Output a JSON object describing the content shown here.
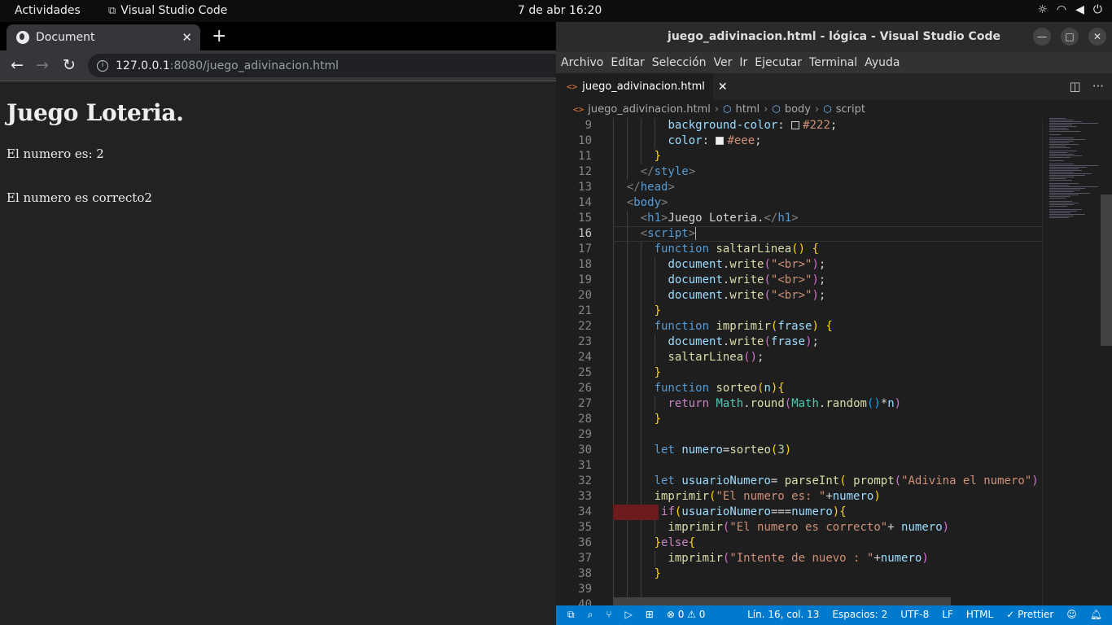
{
  "topbar": {
    "activities": "Actividades",
    "app_name": "Visual Studio Code",
    "clock": "7 de abr  16:20",
    "tray_icons": [
      "brightness-icon",
      "wifi-icon",
      "volume-icon",
      "power-icon"
    ]
  },
  "browser": {
    "tab_title": "Document",
    "url_host": "127.0.0.1",
    "url_path": ":8080/juego_adivinacion.html",
    "page": {
      "heading": "Juego Loteria.",
      "line1": "El numero es: 2",
      "line2": "El numero es correcto2"
    }
  },
  "vscode": {
    "window_title": "juego_adivinacion.html - lógica - Visual Studio Code",
    "menu": [
      "Archivo",
      "Editar",
      "Selección",
      "Ver",
      "Ir",
      "Ejecutar",
      "Terminal",
      "Ayuda"
    ],
    "tab_label": "juego_adivinacion.html",
    "breadcrumb": {
      "file": "juego_adivinacion.html",
      "b1": "html",
      "b2": "body",
      "b3": "script"
    },
    "status": {
      "errors": "0",
      "warnings": "0",
      "position": "Lín. 16, col. 13",
      "spaces": "Espacios: 2",
      "encoding": "UTF-8",
      "eol": "LF",
      "language": "HTML",
      "formatter": "Prettier"
    },
    "colors": {
      "statusbar": "#007acc",
      "editor_bg": "#1e1e1e"
    }
  },
  "code_lines": [
    {
      "n": "9",
      "html": "<span class='prop'>background-color</span>: <span class='sw' style='background:#222'></span><span class='str'>#222</span>;"
    },
    {
      "n": "10",
      "html": "<span class='prop'>color</span>: <span class='sw' style='background:#eee'></span><span class='str'>#eee</span>;"
    },
    {
      "n": "11",
      "html": "<span class='br'>}</span>"
    },
    {
      "n": "12",
      "html": "<span class='ang'>&lt;/</span><span class='tag'>style</span><span class='ang'>&gt;</span>"
    },
    {
      "n": "13",
      "html": "<span class='ang'>&lt;/</span><span class='tag'>head</span><span class='ang'>&gt;</span>"
    },
    {
      "n": "14",
      "html": "<span class='ang'>&lt;</span><span class='tag'>body</span><span class='ang'>&gt;</span>"
    },
    {
      "n": "15",
      "html": "<span class='ang'>&lt;</span><span class='tag'>h1</span><span class='ang'>&gt;</span>Juego Loteria.<span class='ang'>&lt;/</span><span class='tag'>h1</span><span class='ang'>&gt;</span>"
    },
    {
      "n": "16",
      "html": "<span class='ang'>&lt;</span><span class='tag'>script</span><span class='ang'>&gt;</span><span style='border-left:1px solid #aeafad'></span>"
    },
    {
      "n": "17",
      "html": "<span class='kw'>function</span> <span class='fn'>saltarLinea</span><span class='br'>()</span> <span class='br'>{</span>"
    },
    {
      "n": "18",
      "html": "<span class='var'>document</span>.<span class='fn'>write</span><span class='br2'>(</span><span class='str'>\"&lt;br&gt;\"</span><span class='br2'>)</span>;"
    },
    {
      "n": "19",
      "html": "<span class='var'>document</span>.<span class='fn'>write</span><span class='br2'>(</span><span class='str'>\"&lt;br&gt;\"</span><span class='br2'>)</span>;"
    },
    {
      "n": "20",
      "html": "<span class='var'>document</span>.<span class='fn'>write</span><span class='br2'>(</span><span class='str'>\"&lt;br&gt;\"</span><span class='br2'>)</span>;"
    },
    {
      "n": "21",
      "html": "<span class='br'>}</span>"
    },
    {
      "n": "22",
      "html": "<span class='kw'>function</span> <span class='fn'>imprimir</span><span class='br'>(</span><span class='var'>frase</span><span class='br'>)</span> <span class='br'>{</span>"
    },
    {
      "n": "23",
      "html": "<span class='var'>document</span>.<span class='fn'>write</span><span class='br2'>(</span><span class='var'>frase</span><span class='br2'>)</span>;"
    },
    {
      "n": "24",
      "html": "<span class='fn'>saltarLinea</span><span class='br2'>()</span>;"
    },
    {
      "n": "25",
      "html": "<span class='br'>}</span>"
    },
    {
      "n": "26",
      "html": "<span class='kw'>function</span> <span class='fn'>sorteo</span><span class='br'>(</span><span class='var'>n</span><span class='br'>)</span><span class='br'>{</span>"
    },
    {
      "n": "27",
      "html": "<span class='kw2'>return</span> <span class='cls'>Math</span>.<span class='fn'>round</span><span class='br2'>(</span><span class='cls'>Math</span>.<span class='fn'>random</span><span class='br3'>()</span>*<span class='var'>n</span><span class='br2'>)</span>"
    },
    {
      "n": "28",
      "html": "<span class='br'>}</span>"
    },
    {
      "n": "29",
      "html": ""
    },
    {
      "n": "30",
      "html": "<span class='kw'>let</span> <span class='var'>numero</span>=<span class='fn'>sorteo</span><span class='br'>(</span><span class='num'>3</span><span class='br'>)</span>"
    },
    {
      "n": "31",
      "html": ""
    },
    {
      "n": "32",
      "html": "<span class='kw'>let</span> <span class='var'>usuarioNumero</span>= <span class='fn'>parseInt</span><span class='br'>(</span> <span class='fn'>prompt</span><span class='br2'>(</span><span class='str'>\"Adivina el numero\"</span><span class='br2'>)</span>"
    },
    {
      "n": "33",
      "html": "<span class='fn'>imprimir</span><span class='br'>(</span><span class='str'>\"El numero es: \"</span>+<span class='var'>numero</span><span class='br'>)</span>"
    },
    {
      "n": "34",
      "html": " <span class='kw2'>if</span><span class='br'>(</span><span class='var'>usuarioNumero</span>===<span class='var'>numero</span><span class='br'>)</span><span class='br'>{</span>"
    },
    {
      "n": "35",
      "html": "<span class='fn'>imprimir</span><span class='br2'>(</span><span class='str'>\"El numero es correcto\"</span>+ <span class='var'>numero</span><span class='br2'>)</span>"
    },
    {
      "n": "36",
      "html": "<span class='br'>}</span><span class='kw2'>else</span><span class='br'>{</span>"
    },
    {
      "n": "37",
      "html": "<span class='fn'>imprimir</span><span class='br2'>(</span><span class='str'>\"Intente de nuevo : \"</span>+<span class='var'>numero</span><span class='br2'>)</span>"
    },
    {
      "n": "38",
      "html": "<span class='br'>}</span>"
    },
    {
      "n": "39",
      "html": ""
    },
    {
      "n": "40",
      "html": ""
    }
  ]
}
